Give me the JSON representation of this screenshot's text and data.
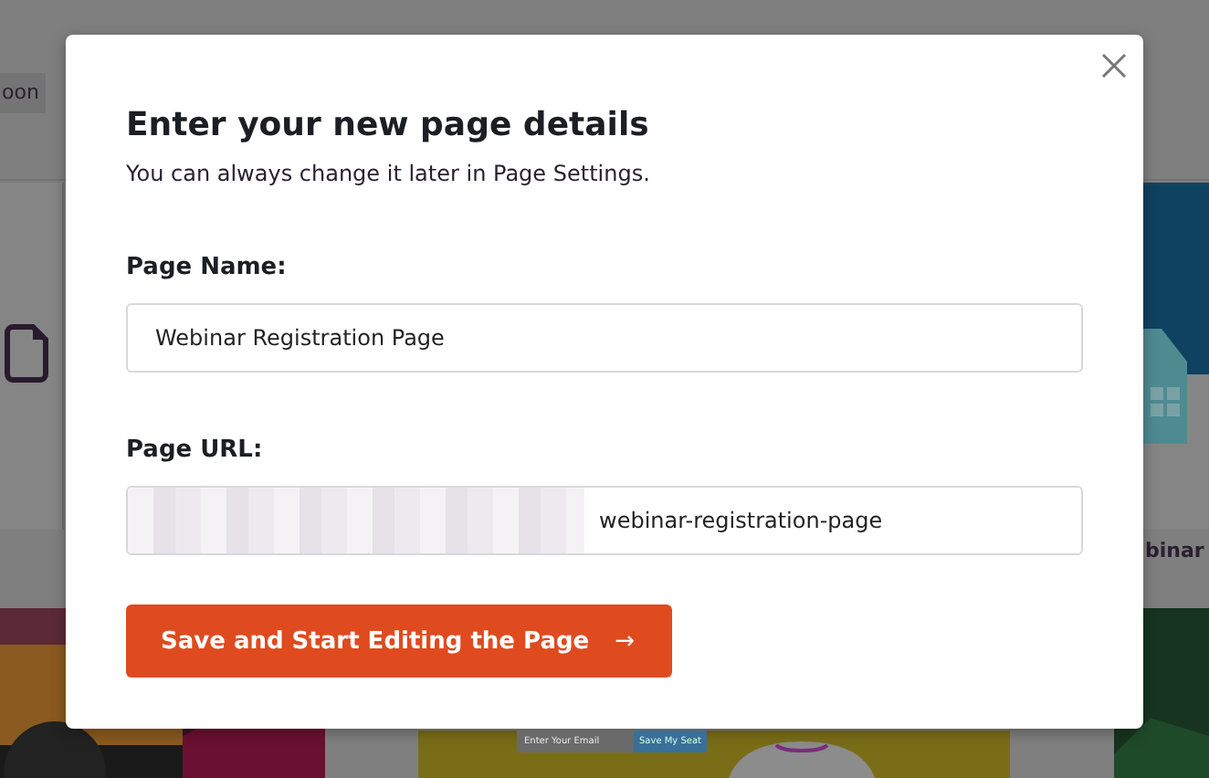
{
  "background": {
    "filter_tab": "oon",
    "card_title": "binar",
    "template_form": {
      "email_placeholder": "Enter Your Email",
      "button": "Save My Seat"
    }
  },
  "dialog": {
    "title": "Enter your new page details",
    "subtitle": "You can always change it later in Page Settings.",
    "fields": [
      {
        "kind": "text",
        "label": "Page Name:",
        "value": "Webinar Registration Page"
      },
      {
        "kind": "url",
        "label": "Page URL:",
        "value": "webinar-registration-page"
      }
    ],
    "button": {
      "label": "Save and Start Editing the Page",
      "arrow": "→"
    }
  }
}
